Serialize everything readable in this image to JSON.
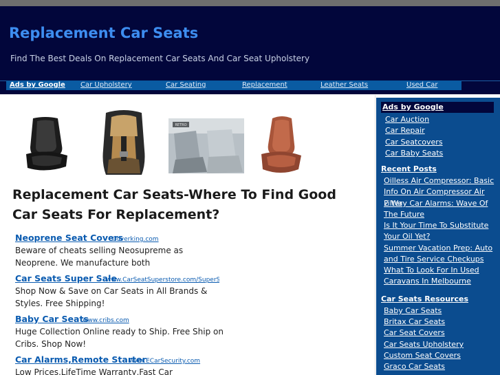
{
  "header": {
    "title": "Replacement Car Seats",
    "description": "Find The Best Deals On Replacement Car Seats And Car Seat Upholstery"
  },
  "adbar": {
    "label": "Ads by Google",
    "links": [
      "Car Upholstery",
      "Car Seating",
      "Replacement",
      "Leather Seats",
      "Used Car"
    ]
  },
  "product_images": {
    "image3_label": "RETRO"
  },
  "post": {
    "title": "Replacement Car Seats-Where To Find Good Car Seats For Replacement?"
  },
  "ads": [
    {
      "title": "Neoprene Seat Covers",
      "domain": "Coverking.com",
      "desc": "Beware of cheats selling Neosupreme as Neoprene. We manufacture both"
    },
    {
      "title": "Car Seats Super Sale",
      "domain": "www.CarSeatSuperstore.com/SuperSale",
      "desc": "Shop Now & Save on Car Seats in All Brands & Styles. Free Shipping!"
    },
    {
      "title": "Baby Car Seats",
      "domain": "www.cribs.com",
      "desc": "Huge Collection Online ready to Ship. Free Ship on Cribs. Shop Now!"
    },
    {
      "title": "Car Alarms,Remote Starter",
      "domain": "www.ECarSecurity.com",
      "desc": "Low Prices,LifeTime Warranty,Fast Car"
    }
  ],
  "sidebar": {
    "ads_heading": "Ads by Google",
    "ad_links": [
      "Car Auction",
      "Car Repair",
      "Car Seatcovers",
      "Car Baby Seats"
    ],
    "recent_heading": "Recent Posts",
    "recent_posts": [
      "Oilless Air Compressor: Basic Info On Air Compressor Air Filter",
      "2 Way Car Alarms: Wave Of The Future",
      "Is It Your Time To Substitute Your Oil Yet?",
      "Summer Vacation Prep: Auto and Tire Service Checkups",
      "What To Look For In Used Caravans In Melbourne"
    ],
    "resources_heading": "Car Seats Resources",
    "resources": [
      "Baby Car Seats",
      "Britax Car Seats",
      "Car Seat Covers",
      "Car Seats Upholstery",
      "Custom Seat Covers",
      "Graco Car Seats"
    ]
  },
  "colors": {
    "header_bg": "#02063b",
    "title_blue": "#3d8df0",
    "sidebar_bg": "#0b4c8f",
    "adbar_bg": "#0a5ba2",
    "link_blue": "#0a5bb0"
  }
}
